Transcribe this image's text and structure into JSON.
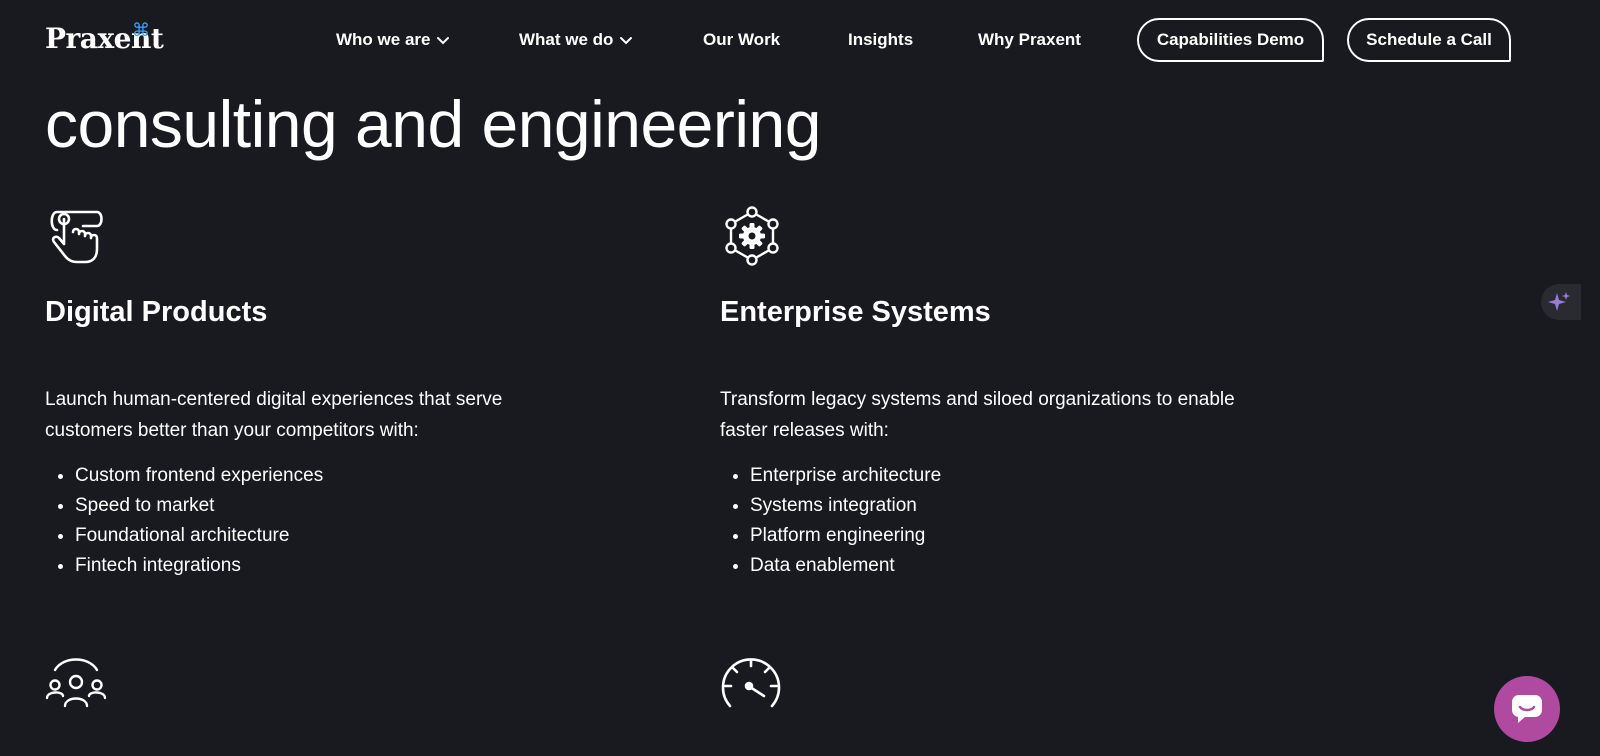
{
  "header": {
    "logo": "Praxent",
    "logo_mark": "⌘",
    "nav": [
      {
        "label": "Who we are",
        "has_dropdown": true
      },
      {
        "label": "What we do",
        "has_dropdown": true
      },
      {
        "label": "Our Work",
        "has_dropdown": false
      },
      {
        "label": "Insights",
        "has_dropdown": false
      },
      {
        "label": "Why Praxent",
        "has_dropdown": false
      }
    ],
    "buttons": {
      "demo": "Capabilities Demo",
      "call": "Schedule a Call"
    }
  },
  "hero": {
    "heading": "consulting and engineering"
  },
  "services": [
    {
      "icon": "touch-hand-icon",
      "title": "Digital Products",
      "description": "Launch human-centered digital experiences that serve customers better than your competitors with:",
      "items": [
        "Custom frontend experiences",
        "Speed to market",
        "Foundational architecture",
        "Fintech integrations"
      ]
    },
    {
      "icon": "gear-network-icon",
      "title": "Enterprise Systems",
      "description": "Transform legacy systems and siloed organizations to enable faster releases with:",
      "items": [
        "Enterprise architecture",
        "Systems integration",
        "Platform engineering",
        "Data enablement"
      ]
    }
  ],
  "next_icons": [
    "team-group-icon",
    "speedometer-icon"
  ],
  "colors": {
    "background": "#191920",
    "text": "#ffffff",
    "logo_accent": "#3aa0ff",
    "chat_bubble": "#b04aa0",
    "sparkle": "#9b7bd8"
  }
}
